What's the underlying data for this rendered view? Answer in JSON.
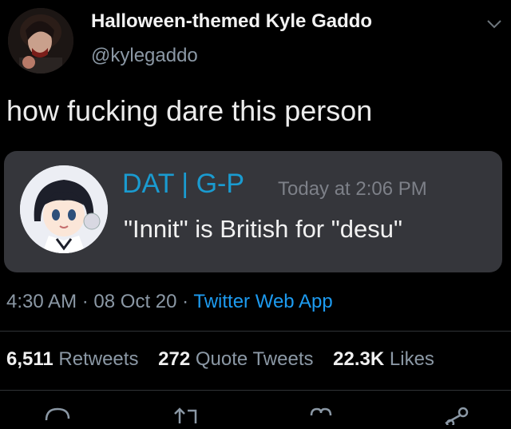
{
  "author": {
    "display_name": "Halloween-themed Kyle Gaddo",
    "handle": "@kylegaddo"
  },
  "tweet": {
    "text": "how fucking dare this person"
  },
  "embed": {
    "name": "DAT | G-P",
    "timestamp": "Today at 2:06 PM",
    "message": "\"Innit\" is British for \"desu\""
  },
  "meta": {
    "time": "4:30 AM",
    "separator": "·",
    "date": "08 Oct 20",
    "source": "Twitter Web App"
  },
  "stats": {
    "retweets_count": "6,511",
    "retweets_label": "Retweets",
    "quotes_count": "272",
    "quotes_label": "Quote Tweets",
    "likes_count": "22.3K",
    "likes_label": "Likes"
  },
  "colors": {
    "background": "#000000",
    "link": "#1d9bf0",
    "embed_bg": "#35363b",
    "embed_name": "#1a9bd0"
  },
  "icons": [
    "chevron-down-icon",
    "reply-icon",
    "retweet-icon",
    "like-icon",
    "share-icon"
  ]
}
